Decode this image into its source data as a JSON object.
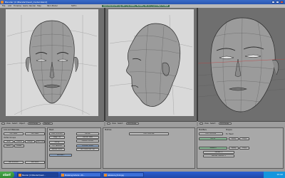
{
  "window": {
    "title": "Blender [C:\\Blender\\head_model.blend]",
    "controls": [
      "minimize",
      "maximize",
      "close"
    ]
  },
  "menubar": {
    "items": [
      "File",
      "Add",
      "Timeline",
      "Game",
      "Render",
      "Help"
    ],
    "screen": "SR:2-Model",
    "scene": "SCE:1",
    "stats": "www.blender3d.org 243 | Ve:1049 | Fa:998 | Ob:1-1 | La:0 Mem:5.96M"
  },
  "viewports": [
    {
      "name": "Front",
      "icon": "face-front-icon"
    },
    {
      "name": "Side",
      "icon": "face-side-icon"
    },
    {
      "name": "Perspective",
      "icon": "face-persp-icon"
    }
  ],
  "vp_headers": {
    "view": "View",
    "select": "Select",
    "object": "Object",
    "mode": "Edit Mode",
    "pivot": "Median"
  },
  "panels": {
    "link": {
      "title": "Link and Materials",
      "me": "ME:Head",
      "ob": "OB:Head",
      "vertex_group": "Vertex Groups",
      "new": "New",
      "delete": "Delete",
      "assign": "Assign",
      "remove": "Remove",
      "select": "Select",
      "deselect": "Desel.",
      "set_smooth": "Set Smooth",
      "set_solid": "Set Solid"
    },
    "mesh": {
      "title": "Mesh",
      "auto_smooth": "Auto Smooth",
      "degr": "Degr: 30",
      "sticky": "Sticky",
      "uv_texture": "UV Texture",
      "vertex_color": "Vertex Color",
      "tex_mesh": "TexMesh:",
      "center": "Center",
      "center_new": "Center New",
      "center_cursor": "Center Cursor",
      "double_sided": "Double Sided",
      "no_v_normal_flip": "No V.Normal Flip"
    },
    "multires": {
      "title": "Multires",
      "add_multires": "Add Multires"
    },
    "modifiers": {
      "title": "Modifiers",
      "tab2": "Shapes",
      "add_modifier": "Add Modifier",
      "to": "To: Head",
      "mirror": "Mirror",
      "subsurf": "Subsurf",
      "apply": "Apply",
      "copy": "Copy",
      "levels": "Levels: 2",
      "render_levels": "Render Levels: 2"
    }
  },
  "taskbar": {
    "start": "start",
    "tasks": [
      "Blender [C:\\Blender\\head...",
      "Modeling tutorial - Mi...",
      "reference_front.jpg"
    ],
    "clock": "10:42"
  },
  "colors": {
    "viewport_bg": "#6f6f6f",
    "mesh_face": "#9a9a9a",
    "wire": "#2a2a2a",
    "ref_bg": "#d9d9d9",
    "titlebar": "#2a56b0",
    "taskbar": "#1f48a8"
  }
}
